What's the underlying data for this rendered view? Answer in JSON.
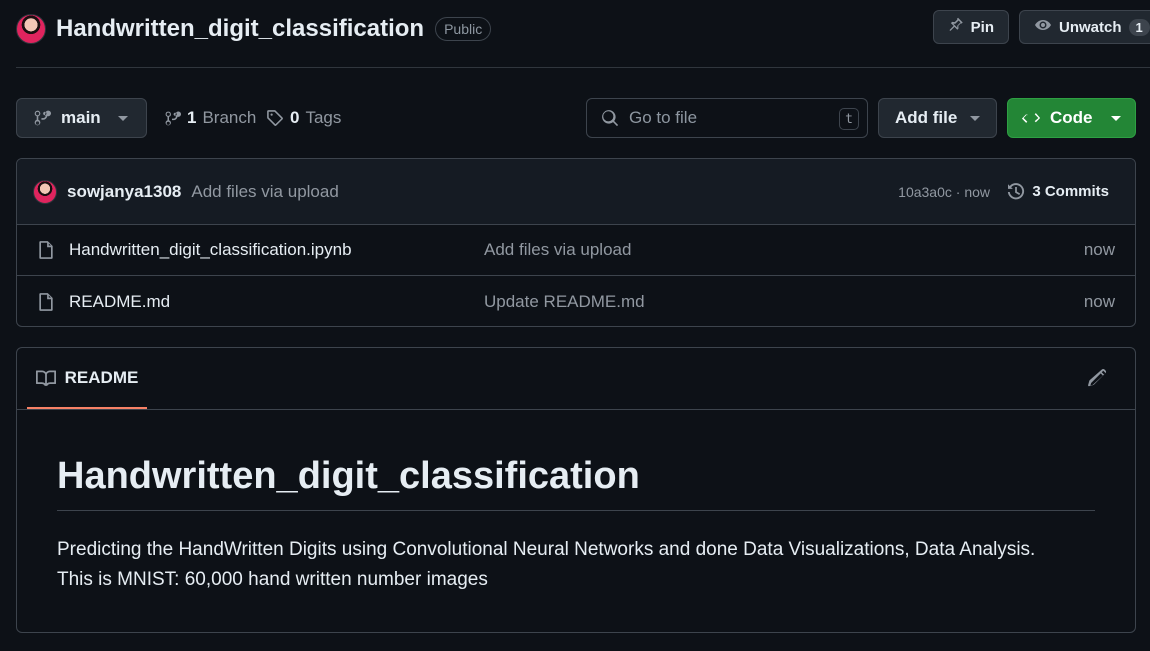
{
  "repo": {
    "name": "Handwritten_digit_classification",
    "visibility": "Public"
  },
  "header_actions": {
    "pin_label": "Pin",
    "unwatch_label": "Unwatch",
    "watch_count": "1"
  },
  "toolbar": {
    "branch": "main",
    "branch_count": "1",
    "branch_label": "Branch",
    "tag_count": "0",
    "tag_label": "Tags",
    "search_placeholder": "Go to file",
    "search_shortcut": "t",
    "add_file_label": "Add file",
    "code_label": "Code"
  },
  "latest_commit": {
    "author": "sowjanya1308",
    "message": "Add files via upload",
    "hash_time": "10a3a0c · now",
    "commits_label": "3 Commits"
  },
  "files": [
    {
      "name": "Handwritten_digit_classification.ipynb",
      "message": "Add files via upload",
      "time": "now"
    },
    {
      "name": "README.md",
      "message": "Update README.md",
      "time": "now"
    }
  ],
  "readme": {
    "tab_label": "README",
    "heading": "Handwritten_digit_classification",
    "line1": "Predicting the HandWritten Digits using Convolutional Neural Networks and done Data Visualizations, Data Analysis.",
    "line2": "This is MNIST: 60,000 hand written number images"
  },
  "colors": {
    "background": "#0d1117",
    "code_button": "#238636",
    "tab_underline": "#f78166"
  }
}
